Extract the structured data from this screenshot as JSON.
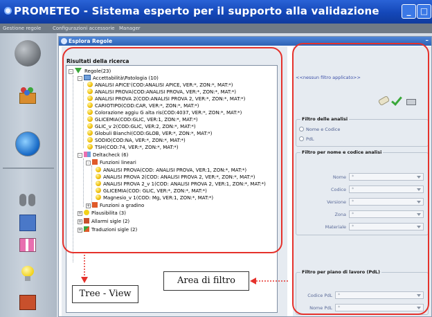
{
  "window": {
    "title": "PROMETEO - Sistema esperto per il supporto alla validazione"
  },
  "menu": [
    "Gestione regole",
    "Configurazioni accessorie",
    "Manager"
  ],
  "dock": {
    "title": "Esplora Regole"
  },
  "tree": {
    "results_title": "Risultati della ricerca",
    "root": "Regole(23)",
    "acc": {
      "label": "Accettabilità\\Patologia (10)",
      "children": [
        "ANALISI APICE'(COD:ANALISI APICE, VER:*, ZON:*, MAT:*)",
        "ANALISI PROVA(COD:ANALISI PROVA, VER:*, ZON:*, MAT:*)",
        "ANALISI PROVA 2(COD:ANALISI PROVA 2, VER:*, ZON:*, MAT:*)",
        "CARIOTIPO(COD:CAR, VER:*, ZON:*, MAT:*)",
        "Colorazione aggiu G alta ris(COD:4037, VER:*, ZON:*, MAT:*)",
        "GLICEMIA(COD:GLIC, VER:1, ZON:*, MAT:*)",
        "GLIC_v 2(COD:GLIC, VER:2, ZON:*, MAT:*)",
        "Globuli Bianchi(COD:GLOB, VER:*, ZON:*, MAT:*)",
        "SODIO(COD:NA, VER:*, ZON:*, MAT:*)",
        "TSH(COD:74, VER:*, ZON:*, MAT:*)"
      ]
    },
    "delta": {
      "label": "Deltacheck (6)",
      "lin": {
        "label": "Funzioni lineari",
        "children": [
          "ANALISI PROVA(COD: ANALISI PROVA, VER:1, ZON:*, MAT:*)",
          "ANALISI PROVA 2(COD: ANALISI PROVA 2, VER:*, ZON:*, MAT:*)",
          "ANALISI PROVA 2_v 1(COD: ANALISI PROVA 2, VER:1, ZON:*, MAT:*)",
          "GLICEMIA(COD: GLIC, VER:*, ZON:*, MAT:*)",
          "Magnesio_v 1(COD: Mg, VER:1, ZON:*, MAT:*)"
        ]
      },
      "grad": "Funzioni a gradino"
    },
    "plaus": "Plausibilita (3)",
    "allarmi": "Allarmi sigle (2)",
    "trad": "Traduzioni sigle (2)"
  },
  "filter": {
    "no_filter": "<<nessun filtro applicato>>",
    "analisi_group": "Filtro delle analisi",
    "radio1": "Nome e Codice",
    "radio2": "PdL",
    "nome_group": "Filtro per nome e codice analisi",
    "fields": [
      {
        "label": "Nome",
        "value": "*"
      },
      {
        "label": "Codice",
        "value": "*"
      },
      {
        "label": "Versione",
        "value": "*"
      },
      {
        "label": "Zona",
        "value": "*"
      },
      {
        "label": "Materiale",
        "value": "*"
      }
    ],
    "pdl_group": "Filtro per piano di lavoro (PdL)",
    "pdl_fields": [
      {
        "label": "Codice PdL",
        "value": "*"
      },
      {
        "label": "Nome PdL",
        "value": "*"
      }
    ]
  },
  "annotations": {
    "tree_view": "Tree - View",
    "area_filtro": "Area di filtro"
  },
  "colors": {
    "title_bar": "#1447b8",
    "menu_bar": "#6f7a86",
    "dock_header": "#2d62b4",
    "highlight": "#e5312b"
  },
  "icons": [
    "app-icon",
    "minimize-icon",
    "maximize-icon",
    "close-icon",
    "globe-icon",
    "binoculars-icon",
    "lightbulb-icon",
    "eraser-icon",
    "checkmark-icon",
    "print-icon"
  ]
}
